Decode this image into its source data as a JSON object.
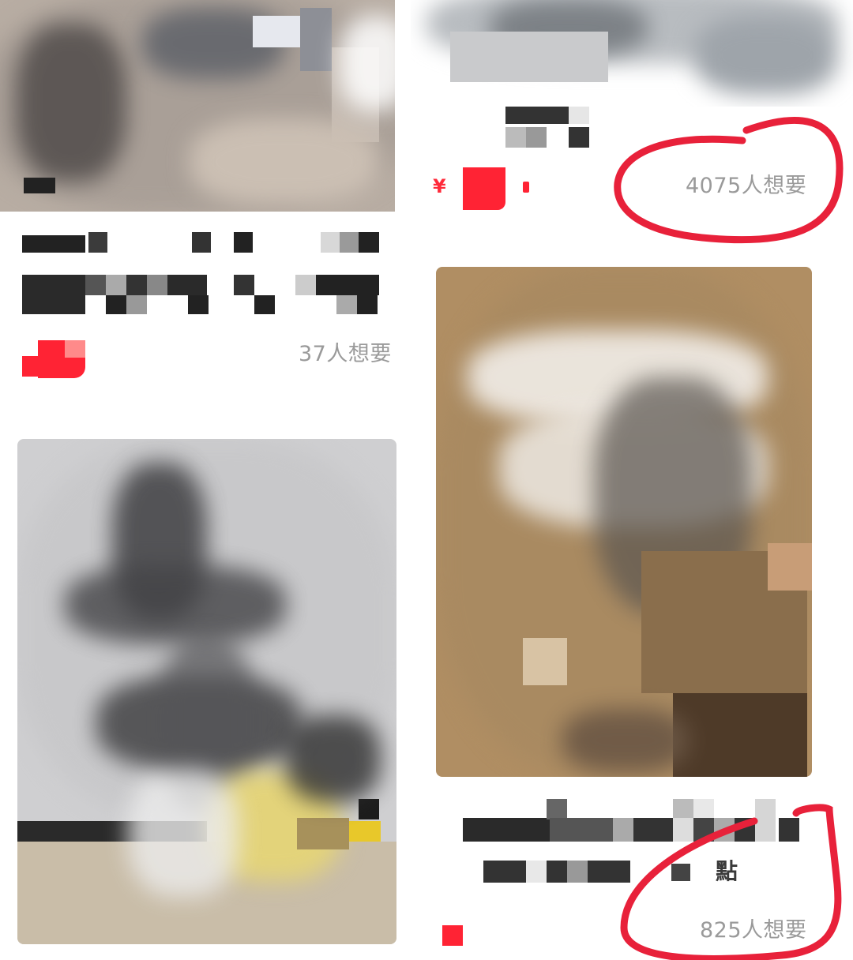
{
  "feed": {
    "items": [
      {
        "want_count": "37人想要"
      },
      {
        "price_symbol": "¥",
        "want_count": "4075人想要"
      },
      {
        "title_fragment": "點"
      },
      {
        "want_count": "825人想要"
      }
    ]
  },
  "colors": {
    "accent_red": "#ff2334",
    "annotation_red": "#e8213a",
    "muted_text": "#9a9a9a"
  }
}
